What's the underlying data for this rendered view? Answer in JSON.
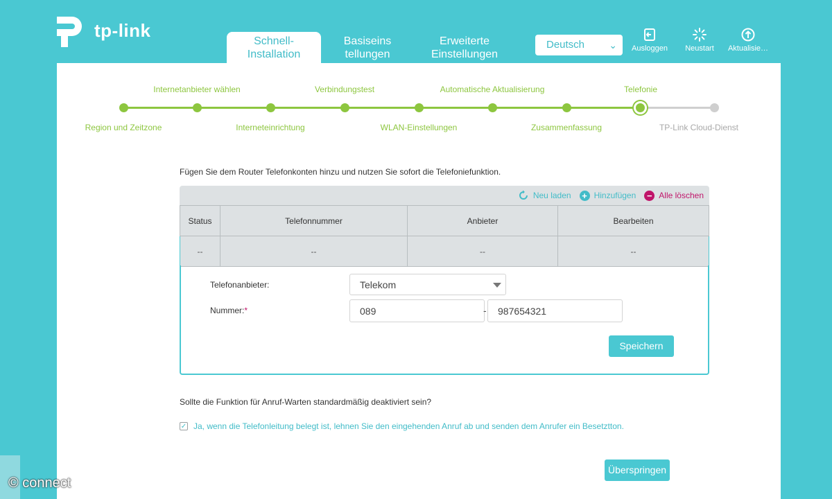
{
  "header": {
    "logo_text": "tp-link",
    "tabs": [
      {
        "label": "Schnell-\nInstallation",
        "line1": "Schnell-",
        "line2": "Installation",
        "active": true
      },
      {
        "label": "Basiseinstellungen",
        "line1": "Basiseins",
        "line2": "tellungen",
        "active": false
      },
      {
        "label": "Erweiterte Einstellungen",
        "line1": "Erweiterte",
        "line2": "Einstellungen",
        "active": false
      }
    ],
    "language": "Deutsch",
    "buttons": [
      {
        "label": "Ausloggen",
        "icon": "logout-icon"
      },
      {
        "label": "Neustart",
        "icon": "restart-icon"
      },
      {
        "label": "Aktualisie…",
        "icon": "update-icon"
      }
    ]
  },
  "stepper": {
    "steps": [
      {
        "label": "Region und Zeitzone",
        "state": "done"
      },
      {
        "label": "Internetanbieter wählen",
        "state": "done"
      },
      {
        "label": "Interneteinrichtung",
        "state": "done"
      },
      {
        "label": "Verbindungstest",
        "state": "done"
      },
      {
        "label": "WLAN-Einstellungen",
        "state": "done"
      },
      {
        "label": "Automatische Aktualisierung",
        "state": "done"
      },
      {
        "label": "Zusammenfassung",
        "state": "done"
      },
      {
        "label": "Telefonie",
        "state": "current"
      },
      {
        "label": "TP-Link Cloud-Dienst",
        "state": "pending"
      }
    ]
  },
  "content": {
    "intro": "Fügen Sie dem Router Telefonkonten hinzu und nutzen Sie sofort die Telefoniefunktion.",
    "toolbar": {
      "reload": "Neu laden",
      "add": "Hinzufügen",
      "delete_all": "Alle löschen"
    },
    "table": {
      "headers": [
        "Status",
        "Telefonnummer",
        "Anbieter",
        "Bearbeiten"
      ],
      "row": [
        "--",
        "--",
        "--",
        "--"
      ]
    },
    "form": {
      "provider_label": "Telefonanbieter:",
      "provider_value": "Telekom",
      "number_label": "Nummer:",
      "required_mark": "*",
      "area_code": "089",
      "separator": "-",
      "number": "987654321",
      "save": "Speichern"
    },
    "question": "Sollte die Funktion für Anruf-Warten standardmäßig deaktiviert sein?",
    "checkbox": {
      "checked": true,
      "label": "Ja, wenn die Telefonleitung belegt ist, lehnen Sie den eingehenden Anruf ab und senden dem Anrufer ein Besetztton."
    },
    "skip": "Überspringen"
  },
  "watermark": "© connect",
  "colors": {
    "background": "#4ac8d2",
    "accent": "#42bcc8",
    "progress": "#8dc63f",
    "pending": "#cfcfcf",
    "danger": "#c0156a"
  }
}
